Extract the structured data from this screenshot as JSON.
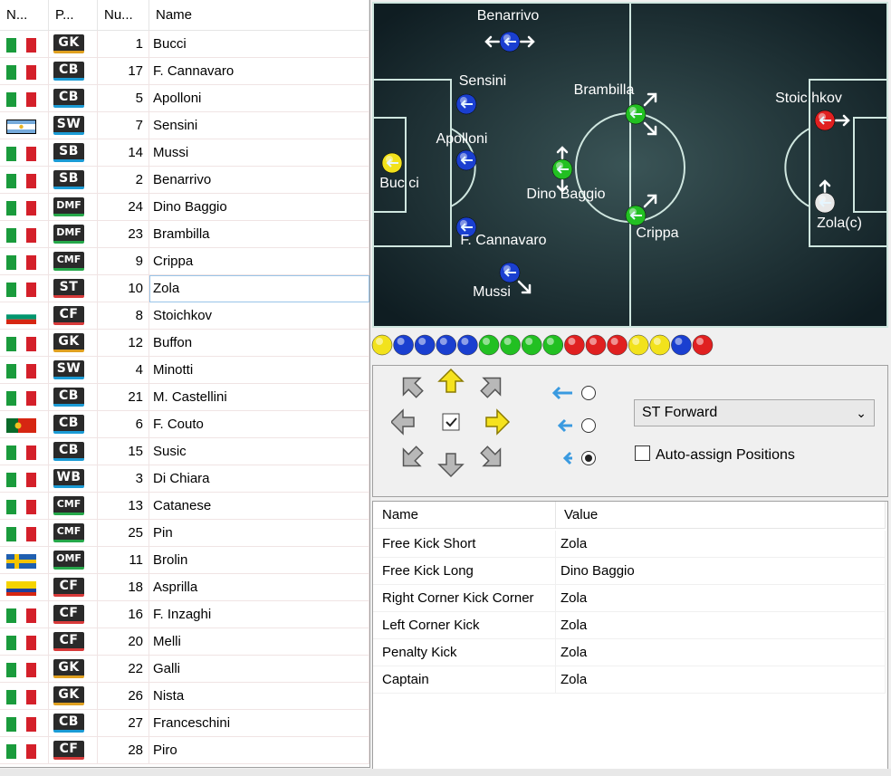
{
  "roster": {
    "headers": [
      "N...",
      "P...",
      "Nu...",
      "Name"
    ],
    "rows": [
      {
        "flag": "italy",
        "pos": "GK",
        "num": "1",
        "name": "Bucci"
      },
      {
        "flag": "italy",
        "pos": "CB",
        "num": "17",
        "name": "F. Cannavaro"
      },
      {
        "flag": "italy",
        "pos": "CB",
        "num": "5",
        "name": "Apolloni"
      },
      {
        "flag": "argentina",
        "pos": "SW",
        "num": "7",
        "name": "Sensini"
      },
      {
        "flag": "italy",
        "pos": "SB",
        "num": "14",
        "name": "Mussi"
      },
      {
        "flag": "italy",
        "pos": "SB",
        "num": "2",
        "name": "Benarrivo"
      },
      {
        "flag": "italy",
        "pos": "DMF",
        "num": "24",
        "name": "Dino Baggio"
      },
      {
        "flag": "italy",
        "pos": "DMF",
        "num": "23",
        "name": "Brambilla"
      },
      {
        "flag": "italy",
        "pos": "CMF",
        "num": "9",
        "name": "Crippa"
      },
      {
        "flag": "italy",
        "pos": "ST",
        "num": "10",
        "name": "Zola"
      },
      {
        "flag": "bulgaria",
        "pos": "CF",
        "num": "8",
        "name": "Stoichkov"
      },
      {
        "flag": "italy",
        "pos": "GK",
        "num": "12",
        "name": "Buffon"
      },
      {
        "flag": "italy",
        "pos": "SW",
        "num": "4",
        "name": "Minotti"
      },
      {
        "flag": "italy",
        "pos": "CB",
        "num": "21",
        "name": "M. Castellini"
      },
      {
        "flag": "portugal",
        "pos": "CB",
        "num": "6",
        "name": "F. Couto"
      },
      {
        "flag": "italy",
        "pos": "CB",
        "num": "15",
        "name": "Susic"
      },
      {
        "flag": "italy",
        "pos": "WB",
        "num": "3",
        "name": "Di Chiara"
      },
      {
        "flag": "italy",
        "pos": "CMF",
        "num": "13",
        "name": "Catanese"
      },
      {
        "flag": "italy",
        "pos": "CMF",
        "num": "25",
        "name": "Pin"
      },
      {
        "flag": "sweden",
        "pos": "OMF",
        "num": "11",
        "name": "Brolin"
      },
      {
        "flag": "colombia",
        "pos": "CF",
        "num": "18",
        "name": "Asprilla"
      },
      {
        "flag": "italy",
        "pos": "CF",
        "num": "16",
        "name": "F. Inzaghi"
      },
      {
        "flag": "italy",
        "pos": "CF",
        "num": "20",
        "name": "Melli"
      },
      {
        "flag": "italy",
        "pos": "GK",
        "num": "22",
        "name": "Galli"
      },
      {
        "flag": "italy",
        "pos": "GK",
        "num": "26",
        "name": "Nista"
      },
      {
        "flag": "italy",
        "pos": "CB",
        "num": "27",
        "name": "Franceschini"
      },
      {
        "flag": "italy",
        "pos": "CF",
        "num": "28",
        "name": "Piro"
      }
    ],
    "selected_index": 9
  },
  "pitch": {
    "players": [
      {
        "label": "Benarrivo",
        "color": "blue",
        "arrows": "leftright"
      },
      {
        "label": "Sensini",
        "color": "blue",
        "arrows": "none"
      },
      {
        "label": "Apolloni",
        "color": "blue",
        "arrows": "none"
      },
      {
        "label": "Buc ci",
        "color": "yellow",
        "arrows": "none"
      },
      {
        "label": "F. Cannavaro",
        "color": "blue",
        "arrows": "none"
      },
      {
        "label": "Mussi",
        "color": "blue",
        "arrows": "downright"
      },
      {
        "label": "Dino Baggio",
        "color": "green",
        "arrows": "updown"
      },
      {
        "label": "Brambilla",
        "color": "green",
        "arrows": "updown-diag"
      },
      {
        "label": "Crippa",
        "color": "green",
        "arrows": "upright"
      },
      {
        "label": "Stoic hkov",
        "color": "red",
        "arrows": "right"
      },
      {
        "label": "Zola(c)",
        "color": "white",
        "arrows": "up"
      }
    ],
    "colors": {
      "pitch_dark": "#0f1d22",
      "pitch_mid": "#3a5456",
      "line": "#cfe6df",
      "blue": "#1a3fd0",
      "green": "#22c022",
      "yellow": "#f2e21c",
      "red": "#e02020",
      "white": "#e8e8e8",
      "arrow": "#e6f6ff"
    }
  },
  "ball_strip": [
    "yellow",
    "blue",
    "blue",
    "blue",
    "blue",
    "green",
    "green",
    "green",
    "green",
    "red",
    "red",
    "red",
    "yellow",
    "yellow",
    "blue",
    "red"
  ],
  "controls": {
    "direction_icons": [
      "arrow-up-left-icon",
      "arrow-up-icon",
      "arrow-up-right-icon",
      "arrow-left-icon",
      "checkbox-center-icon",
      "arrow-right-icon",
      "arrow-down-left-icon",
      "arrow-down-icon",
      "arrow-down-right-icon"
    ],
    "radio_options": [
      "long-arrow",
      "medium-arrow",
      "short-arrow"
    ],
    "radio_selected": 2,
    "strategy_select": "ST Forward",
    "auto_assign_label": "Auto-assign Positions",
    "auto_assign_checked": false
  },
  "set_pieces": {
    "headers": [
      "Name",
      "Value"
    ],
    "rows": [
      {
        "name": "Free Kick Short",
        "value": "Zola"
      },
      {
        "name": "Free Kick Long",
        "value": "Dino Baggio"
      },
      {
        "name": "Right Corner Kick Corner",
        "value": "Zola"
      },
      {
        "name": "Left Corner Kick",
        "value": "Zola"
      },
      {
        "name": "Penalty Kick",
        "value": "Zola"
      },
      {
        "name": "Captain",
        "value": "Zola"
      }
    ]
  }
}
